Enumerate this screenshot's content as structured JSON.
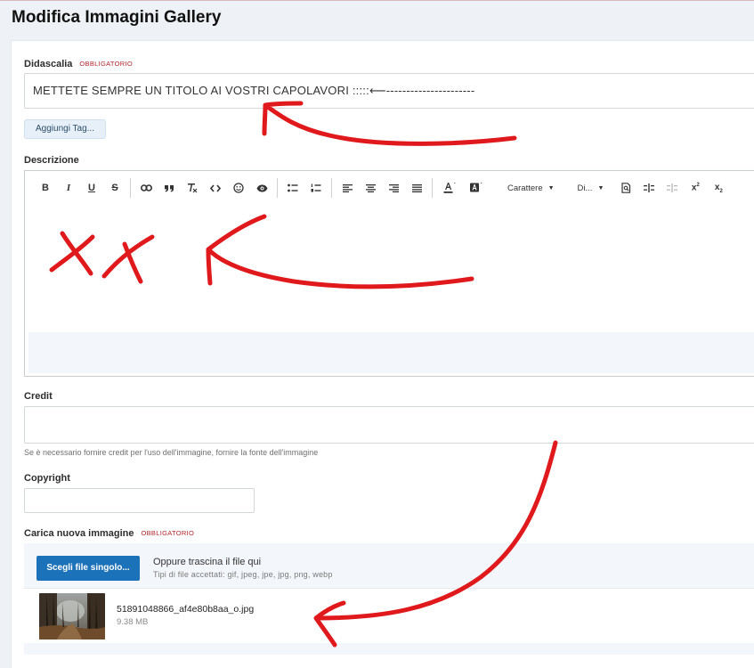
{
  "page": {
    "title": "Modifica Immagini Gallery"
  },
  "caption": {
    "label": "Didascalia",
    "required_tag": "OBBLIGATORIO",
    "value": "METTETE SEMPRE UN TITOLO AI VOSTRI CAPOLAVORI :::::⟵----------------------"
  },
  "tags": {
    "button_label": "Aggiungi Tag..."
  },
  "description": {
    "label": "Descrizione",
    "toolbar": {
      "bold": "B",
      "italic": "I",
      "underline": "U",
      "strikethrough": "S",
      "font_dropdown": "Carattere",
      "size_dropdown": "Di..."
    }
  },
  "credit": {
    "label": "Credit",
    "value": "",
    "help": "Se è necessario fornire credit per l'uso dell'immagine, fornire la fonte dell'immagine"
  },
  "copyright": {
    "label": "Copyright",
    "value": ""
  },
  "upload": {
    "label": "Carica nuova immagine",
    "required_tag": "OBBLIGATORIO",
    "choose_button": "Scegli file singolo...",
    "drop_text": "Oppure trascina il file qui",
    "accepted_types": "Tipi di file accettati: gif, jpeg, jpe, jpg, png, webp",
    "file": {
      "name": "51891048866_af4e80b8aa_o.jpg",
      "size": "9.38 MB"
    }
  },
  "colors": {
    "accent": "#1c72b8",
    "required": "#b0262c",
    "annotation": "#e0191c"
  }
}
